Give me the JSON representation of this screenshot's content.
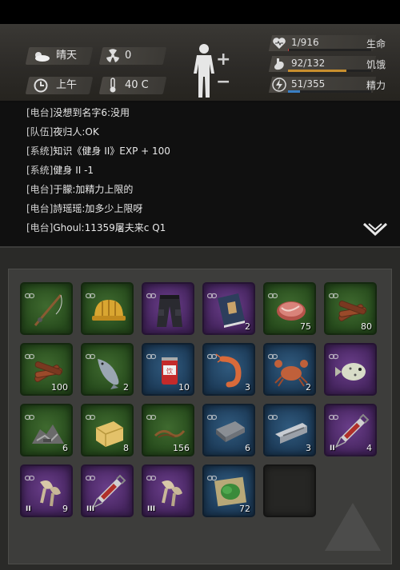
{
  "status": {
    "weather": {
      "icon": "sun-cloud-icon",
      "label": "晴天"
    },
    "radiation": {
      "icon": "radiation-icon",
      "value": "0"
    },
    "time": {
      "icon": "clock-icon",
      "label": "上午"
    },
    "temperature": {
      "icon": "thermometer-icon",
      "value": "40 C"
    },
    "stats": [
      {
        "name": "health",
        "icon": "heart-icon",
        "value": "1/916",
        "label": "生命",
        "fraction": 0.01,
        "color": "#c43a3a"
      },
      {
        "name": "hunger",
        "icon": "stomach-icon",
        "value": "92/132",
        "label": "饥饿",
        "fraction": 0.7,
        "color": "#c98f2e"
      },
      {
        "name": "energy",
        "icon": "lightning-icon",
        "value": "51/355",
        "label": "精力",
        "fraction": 0.144,
        "color": "#3a7fc4"
      }
    ]
  },
  "chat": {
    "lines": [
      {
        "channel": "[电台]",
        "text": "没想到名字6:没用"
      },
      {
        "channel": "[队伍]",
        "text": "夜归人:OK"
      },
      {
        "channel": "[系统]",
        "text": "知识《健身 II》EXP + 100"
      },
      {
        "channel": "[系统]",
        "text": "健身 II -1"
      },
      {
        "channel": "[电台]",
        "text": "于朦:加精力上限的"
      },
      {
        "channel": "[电台]",
        "text": "詩瑶瑶:加多少上限呀"
      },
      {
        "channel": "[电台]",
        "text": "Ghoul:11359屠夫来c Q1"
      }
    ]
  },
  "inventory": {
    "slots": [
      {
        "rarity": "green",
        "icon": "fishing-rod-icon",
        "qty": "",
        "tier": ""
      },
      {
        "rarity": "green",
        "icon": "hard-hat-icon",
        "qty": "",
        "tier": ""
      },
      {
        "rarity": "purple",
        "icon": "cargo-pants-icon",
        "qty": "",
        "tier": ""
      },
      {
        "rarity": "purple",
        "icon": "book-icon",
        "qty": "2",
        "tier": ""
      },
      {
        "rarity": "green",
        "icon": "steak-icon",
        "qty": "75",
        "tier": ""
      },
      {
        "rarity": "green",
        "icon": "firewood-icon",
        "qty": "80",
        "tier": ""
      },
      {
        "rarity": "green",
        "icon": "firewood-icon",
        "qty": "100",
        "tier": ""
      },
      {
        "rarity": "green",
        "icon": "fish-icon",
        "qty": "2",
        "tier": ""
      },
      {
        "rarity": "blue",
        "icon": "soda-can-icon",
        "qty": "10",
        "tier": ""
      },
      {
        "rarity": "blue",
        "icon": "shrimp-icon",
        "qty": "3",
        "tier": ""
      },
      {
        "rarity": "blue",
        "icon": "crab-icon",
        "qty": "2",
        "tier": ""
      },
      {
        "rarity": "purple",
        "icon": "pufferfish-icon",
        "qty": "",
        "tier": ""
      },
      {
        "rarity": "green",
        "icon": "scrap-pile-icon",
        "qty": "6",
        "tier": ""
      },
      {
        "rarity": "green",
        "icon": "butter-icon",
        "qty": "8",
        "tier": ""
      },
      {
        "rarity": "green",
        "icon": "rope-icon",
        "qty": "156",
        "tier": ""
      },
      {
        "rarity": "blue",
        "icon": "iron-ingot-icon",
        "qty": "6",
        "tier": ""
      },
      {
        "rarity": "blue",
        "icon": "steel-beam-icon",
        "qty": "3",
        "tier": ""
      },
      {
        "rarity": "purple",
        "icon": "syringe-icon",
        "qty": "4",
        "tier": "II"
      },
      {
        "rarity": "purple",
        "icon": "mushroom-icon",
        "qty": "9",
        "tier": "II"
      },
      {
        "rarity": "purple",
        "icon": "syringe-icon",
        "qty": "",
        "tier": "III"
      },
      {
        "rarity": "purple",
        "icon": "mushroom-icon",
        "qty": "",
        "tier": "III"
      },
      {
        "rarity": "blue",
        "icon": "herb-map-icon",
        "qty": "72",
        "tier": ""
      },
      {
        "rarity": "empty",
        "icon": "",
        "qty": "",
        "tier": ""
      }
    ]
  }
}
